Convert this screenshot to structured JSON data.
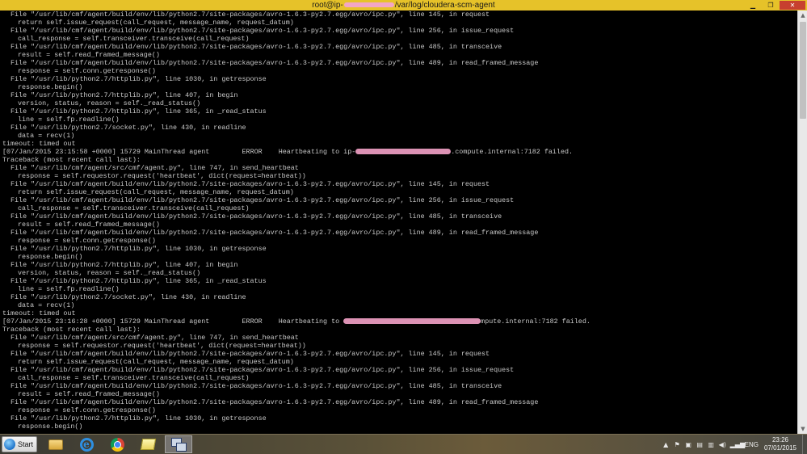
{
  "window": {
    "title_prefix": "root@ip-",
    "title_suffix": "/var/log/cloudera-scm-agent",
    "minimize_glyph": "▁",
    "maximize_glyph": "❐",
    "close_glyph": "✕"
  },
  "terminal": {
    "lines": [
      {
        "t": "File \"/usr/lib/cmf/agent/build/env/lib/python2.7/site-packages/avro-1.6.3-py2.7.egg/avro/ipc.py\", line 145, in request",
        "i": 1
      },
      {
        "t": "return self.issue_request(call_request, message_name, request_datum)",
        "i": 2
      },
      {
        "t": "File \"/usr/lib/cmf/agent/build/env/lib/python2.7/site-packages/avro-1.6.3-py2.7.egg/avro/ipc.py\", line 256, in issue_request",
        "i": 1
      },
      {
        "t": "call_response = self.transceiver.transceive(call_request)",
        "i": 2
      },
      {
        "t": "File \"/usr/lib/cmf/agent/build/env/lib/python2.7/site-packages/avro-1.6.3-py2.7.egg/avro/ipc.py\", line 485, in transceive",
        "i": 1
      },
      {
        "t": "result = self.read_framed_message()",
        "i": 2
      },
      {
        "t": "File \"/usr/lib/cmf/agent/build/env/lib/python2.7/site-packages/avro-1.6.3-py2.7.egg/avro/ipc.py\", line 489, in read_framed_message",
        "i": 1
      },
      {
        "t": "response = self.conn.getresponse()",
        "i": 2
      },
      {
        "t": "File \"/usr/lib/python2.7/httplib.py\", line 1030, in getresponse",
        "i": 1
      },
      {
        "t": "response.begin()",
        "i": 2
      },
      {
        "t": "File \"/usr/lib/python2.7/httplib.py\", line 407, in begin",
        "i": 1
      },
      {
        "t": "version, status, reason = self._read_status()",
        "i": 2
      },
      {
        "t": "File \"/usr/lib/python2.7/httplib.py\", line 365, in _read_status",
        "i": 1
      },
      {
        "t": "line = self.fp.readline()",
        "i": 2
      },
      {
        "t": "File \"/usr/lib/python2.7/socket.py\", line 430, in readline",
        "i": 1
      },
      {
        "t": "data = recv(1)",
        "i": 2
      },
      {
        "t": "timeout: timed out",
        "i": 0
      },
      {
        "t": "[07/Jan/2015 23:15:58 +0000] 15729 MainThread agent        ERROR    Heartbeating to ip-",
        "r": 118,
        "s": ".compute.internal:7182 failed.",
        "i": 0
      },
      {
        "t": "Traceback (most recent call last):",
        "i": 0
      },
      {
        "t": "File \"/usr/lib/cmf/agent/src/cmf/agent.py\", line 747, in send_heartbeat",
        "i": 1
      },
      {
        "t": "response = self.requestor.request('heartbeat', dict(request=heartbeat))",
        "i": 2
      },
      {
        "t": "File \"/usr/lib/cmf/agent/build/env/lib/python2.7/site-packages/avro-1.6.3-py2.7.egg/avro/ipc.py\", line 145, in request",
        "i": 1
      },
      {
        "t": "return self.issue_request(call_request, message_name, request_datum)",
        "i": 2
      },
      {
        "t": "File \"/usr/lib/cmf/agent/build/env/lib/python2.7/site-packages/avro-1.6.3-py2.7.egg/avro/ipc.py\", line 256, in issue_request",
        "i": 1
      },
      {
        "t": "call_response = self.transceiver.transceive(call_request)",
        "i": 2
      },
      {
        "t": "File \"/usr/lib/cmf/agent/build/env/lib/python2.7/site-packages/avro-1.6.3-py2.7.egg/avro/ipc.py\", line 485, in transceive",
        "i": 1
      },
      {
        "t": "result = self.read_framed_message()",
        "i": 2
      },
      {
        "t": "File \"/usr/lib/cmf/agent/build/env/lib/python2.7/site-packages/avro-1.6.3-py2.7.egg/avro/ipc.py\", line 489, in read_framed_message",
        "i": 1
      },
      {
        "t": "response = self.conn.getresponse()",
        "i": 2
      },
      {
        "t": "File \"/usr/lib/python2.7/httplib.py\", line 1030, in getresponse",
        "i": 1
      },
      {
        "t": "response.begin()",
        "i": 2
      },
      {
        "t": "File \"/usr/lib/python2.7/httplib.py\", line 407, in begin",
        "i": 1
      },
      {
        "t": "version, status, reason = self._read_status()",
        "i": 2
      },
      {
        "t": "File \"/usr/lib/python2.7/httplib.py\", line 365, in _read_status",
        "i": 1
      },
      {
        "t": "line = self.fp.readline()",
        "i": 2
      },
      {
        "t": "File \"/usr/lib/python2.7/socket.py\", line 430, in readline",
        "i": 1
      },
      {
        "t": "data = recv(1)",
        "i": 2
      },
      {
        "t": "timeout: timed out",
        "i": 0
      },
      {
        "t": "[07/Jan/2015 23:16:28 +0000] 15729 MainThread agent        ERROR    Heartbeating to ",
        "r": 170,
        "s": "mpute.internal:7182 failed.",
        "i": 0
      },
      {
        "t": "Traceback (most recent call last):",
        "i": 0
      },
      {
        "t": "File \"/usr/lib/cmf/agent/src/cmf/agent.py\", line 747, in send_heartbeat",
        "i": 1
      },
      {
        "t": "response = self.requestor.request('heartbeat', dict(request=heartbeat))",
        "i": 2
      },
      {
        "t": "File \"/usr/lib/cmf/agent/build/env/lib/python2.7/site-packages/avro-1.6.3-py2.7.egg/avro/ipc.py\", line 145, in request",
        "i": 1
      },
      {
        "t": "return self.issue_request(call_request, message_name, request_datum)",
        "i": 2
      },
      {
        "t": "File \"/usr/lib/cmf/agent/build/env/lib/python2.7/site-packages/avro-1.6.3-py2.7.egg/avro/ipc.py\", line 256, in issue_request",
        "i": 1
      },
      {
        "t": "call_response = self.transceiver.transceive(call_request)",
        "i": 2
      },
      {
        "t": "File \"/usr/lib/cmf/agent/build/env/lib/python2.7/site-packages/avro-1.6.3-py2.7.egg/avro/ipc.py\", line 485, in transceive",
        "i": 1
      },
      {
        "t": "result = self.read_framed_message()",
        "i": 2
      },
      {
        "t": "File \"/usr/lib/cmf/agent/build/env/lib/python2.7/site-packages/avro-1.6.3-py2.7.egg/avro/ipc.py\", line 489, in read_framed_message",
        "i": 1
      },
      {
        "t": "response = self.conn.getresponse()",
        "i": 2
      },
      {
        "t": "File \"/usr/lib/python2.7/httplib.py\", line 1030, in getresponse",
        "i": 1
      },
      {
        "t": "response.begin()",
        "i": 2
      }
    ]
  },
  "taskbar": {
    "start_label": "Start",
    "apps": [
      {
        "name": "file-explorer",
        "icon": "folder-icon"
      },
      {
        "name": "internet-explorer",
        "icon": "ie-icon"
      },
      {
        "name": "chrome",
        "icon": "chrome-icon"
      },
      {
        "name": "sticky-notes",
        "icon": "notes-icon"
      },
      {
        "name": "putty",
        "icon": "putty-icon",
        "active": true
      }
    ],
    "tray": {
      "chevron": "▲",
      "icons": [
        "⚑",
        "▣",
        "▤",
        "▥",
        "◀)",
        "▂▄▆"
      ],
      "language": "ENG"
    },
    "clock": {
      "time": "23:26",
      "date": "07/01/2015"
    }
  },
  "scrollbar": {
    "up_glyph": "▲",
    "down_glyph": "▼"
  }
}
